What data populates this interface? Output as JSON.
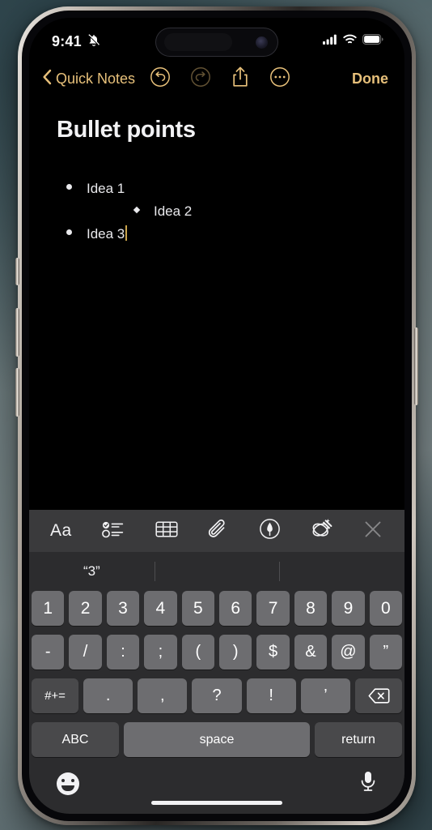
{
  "status_bar": {
    "time": "9:41",
    "silent_icon": "bell-slash-icon",
    "signal_icon": "cellular-signal-icon",
    "wifi_icon": "wifi-icon",
    "battery_icon": "battery-full-icon"
  },
  "nav_bar": {
    "back_label": "Quick Notes",
    "back_icon": "chevron-left-icon",
    "undo_icon": "undo-icon",
    "redo_icon": "redo-icon",
    "share_icon": "share-icon",
    "more_icon": "ellipsis-circle-icon",
    "done_label": "Done",
    "accent_color": "#e7c07a",
    "disabled_color": "#6b5a3a"
  },
  "note": {
    "title": "Bullet points",
    "bullets": [
      {
        "text": "Idea 1",
        "level": 1,
        "marker": "dot"
      },
      {
        "text": "Idea 2",
        "level": 2,
        "marker": "diamond"
      },
      {
        "text": "Idea 3",
        "level": 1,
        "marker": "dot",
        "caret": true
      }
    ],
    "caret_color": "#c9a44c"
  },
  "format_toolbar": {
    "items": [
      {
        "name": "format-aa",
        "label": "Aa"
      },
      {
        "name": "checklist-icon",
        "label": ""
      },
      {
        "name": "table-icon",
        "label": ""
      },
      {
        "name": "paperclip-icon",
        "label": ""
      },
      {
        "name": "markup-pen-icon",
        "label": ""
      },
      {
        "name": "apple-intelligence-icon",
        "label": ""
      },
      {
        "name": "close-icon",
        "label": ""
      }
    ],
    "background": "#3a3a3c"
  },
  "keyboard": {
    "layout": "numbers-symbols",
    "predictions": [
      "“3”",
      "",
      ""
    ],
    "row_numbers": [
      "1",
      "2",
      "3",
      "4",
      "5",
      "6",
      "7",
      "8",
      "9",
      "0"
    ],
    "row_symbols": [
      "-",
      "/",
      ":",
      ";",
      "(",
      ")",
      "$",
      "&",
      "@",
      "”"
    ],
    "row_punct": [
      ".",
      ",",
      "?",
      "!",
      "’"
    ],
    "symbol_toggle": "#+=",
    "delete_icon": "backspace-icon",
    "abc_label": "ABC",
    "space_label": "space",
    "return_label": "return",
    "emoji_icon": "emoji-icon",
    "mic_icon": "microphone-icon",
    "background": "#2c2c2e",
    "key_color": "#6d6d70",
    "dark_key_color": "#49494b"
  }
}
